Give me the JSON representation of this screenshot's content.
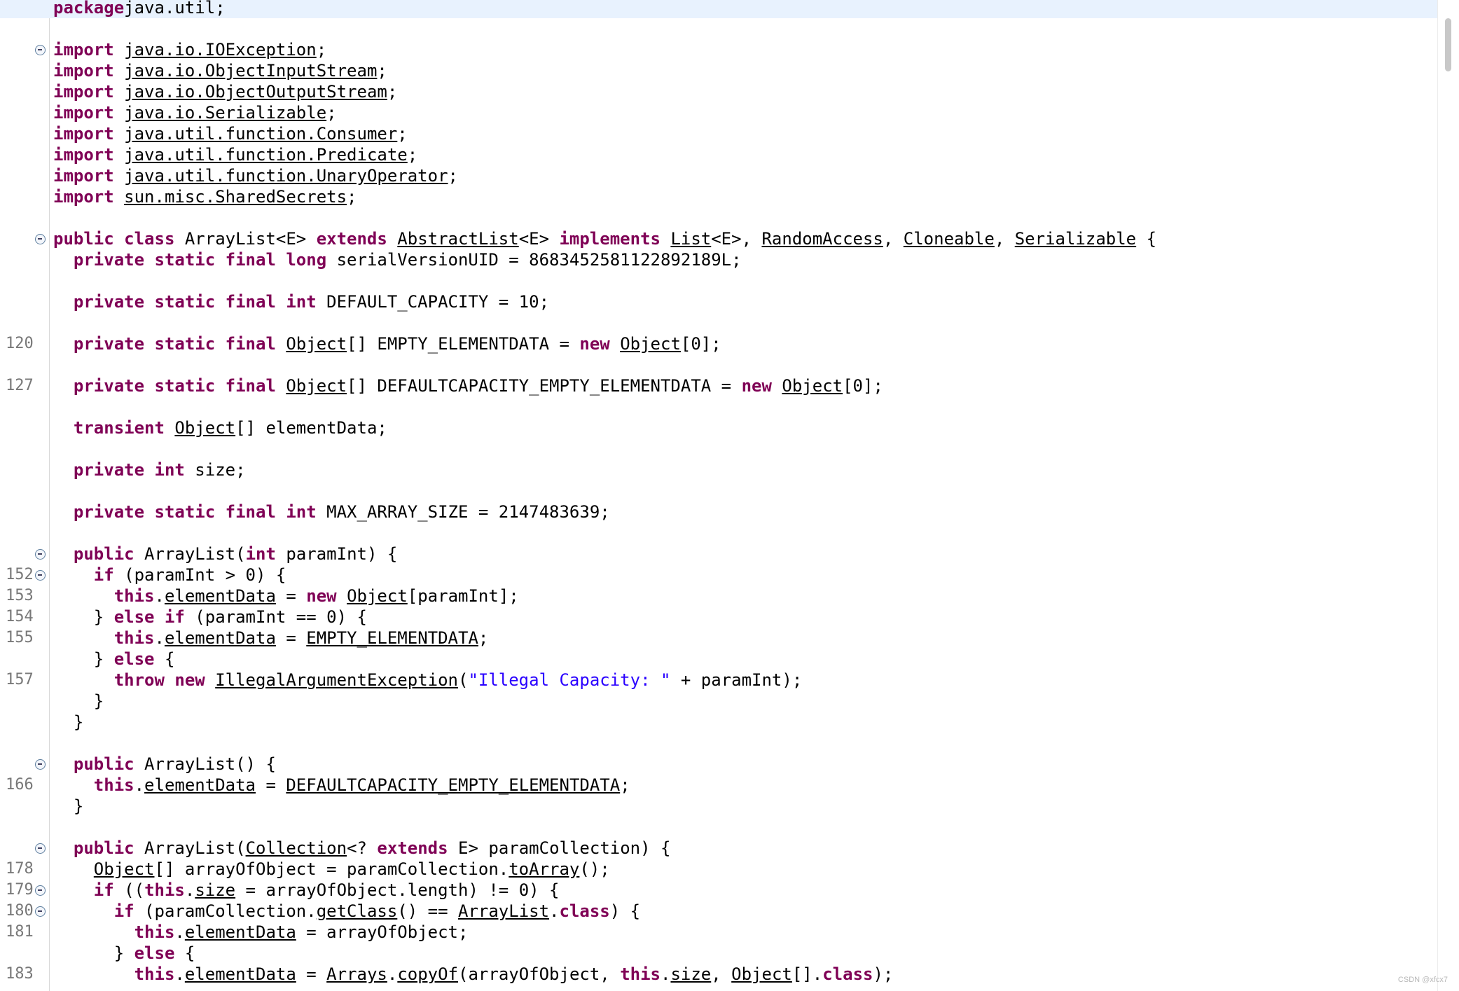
{
  "editor": {
    "lines": [
      {
        "ln": "",
        "fold": false,
        "highlight": true,
        "tokens": [
          [
            "kw",
            "package"
          ],
          [
            "",
            "java.util;"
          ]
        ]
      },
      {
        "ln": "",
        "fold": false,
        "tokens": []
      },
      {
        "ln": "",
        "fold": true,
        "tokens": [
          [
            "kw",
            "import"
          ],
          [
            "",
            " "
          ],
          [
            "ul",
            "java.io.IOException"
          ],
          [
            "",
            ";"
          ]
        ]
      },
      {
        "ln": "",
        "fold": false,
        "tokens": [
          [
            "kw",
            "import"
          ],
          [
            "",
            " "
          ],
          [
            "ul",
            "java.io.ObjectInputStream"
          ],
          [
            "",
            ";"
          ]
        ]
      },
      {
        "ln": "",
        "fold": false,
        "tokens": [
          [
            "kw",
            "import"
          ],
          [
            "",
            " "
          ],
          [
            "ul",
            "java.io.ObjectOutputStream"
          ],
          [
            "",
            ";"
          ]
        ]
      },
      {
        "ln": "",
        "fold": false,
        "tokens": [
          [
            "kw",
            "import"
          ],
          [
            "",
            " "
          ],
          [
            "ul",
            "java.io.Serializable"
          ],
          [
            "",
            ";"
          ]
        ]
      },
      {
        "ln": "",
        "fold": false,
        "tokens": [
          [
            "kw",
            "import"
          ],
          [
            "",
            " "
          ],
          [
            "ul",
            "java.util.function.Consumer"
          ],
          [
            "",
            ";"
          ]
        ]
      },
      {
        "ln": "",
        "fold": false,
        "tokens": [
          [
            "kw",
            "import"
          ],
          [
            "",
            " "
          ],
          [
            "ul",
            "java.util.function.Predicate"
          ],
          [
            "",
            ";"
          ]
        ]
      },
      {
        "ln": "",
        "fold": false,
        "tokens": [
          [
            "kw",
            "import"
          ],
          [
            "",
            " "
          ],
          [
            "ul",
            "java.util.function.UnaryOperator"
          ],
          [
            "",
            ";"
          ]
        ]
      },
      {
        "ln": "",
        "fold": false,
        "tokens": [
          [
            "kw",
            "import"
          ],
          [
            "",
            " "
          ],
          [
            "ul",
            "sun.misc.SharedSecrets"
          ],
          [
            "",
            ";"
          ]
        ]
      },
      {
        "ln": "",
        "fold": false,
        "tokens": []
      },
      {
        "ln": "",
        "fold": true,
        "tokens": [
          [
            "kw",
            "public class"
          ],
          [
            "",
            " ArrayList<E> "
          ],
          [
            "kw",
            "extends"
          ],
          [
            "",
            " "
          ],
          [
            "ul",
            "AbstractList"
          ],
          [
            "",
            "<E> "
          ],
          [
            "kw",
            "implements"
          ],
          [
            "",
            " "
          ],
          [
            "ul",
            "List"
          ],
          [
            "",
            "<E>, "
          ],
          [
            "ul",
            "RandomAccess"
          ],
          [
            "",
            ", "
          ],
          [
            "ul",
            "Cloneable"
          ],
          [
            "",
            ", "
          ],
          [
            "ul",
            "Serializable"
          ],
          [
            "",
            " {"
          ]
        ]
      },
      {
        "ln": "",
        "fold": false,
        "tokens": [
          [
            "",
            "  "
          ],
          [
            "kw",
            "private static final long"
          ],
          [
            "",
            " serialVersionUID = 8683452581122892189L;"
          ]
        ]
      },
      {
        "ln": "",
        "fold": false,
        "tokens": []
      },
      {
        "ln": "",
        "fold": false,
        "tokens": [
          [
            "",
            "  "
          ],
          [
            "kw",
            "private static final int"
          ],
          [
            "",
            " DEFAULT_CAPACITY = 10;"
          ]
        ]
      },
      {
        "ln": "",
        "fold": false,
        "tokens": []
      },
      {
        "ln": "120",
        "fold": false,
        "tokens": [
          [
            "",
            "  "
          ],
          [
            "kw",
            "private static final"
          ],
          [
            "",
            " "
          ],
          [
            "ul",
            "Object"
          ],
          [
            "",
            "[] EMPTY_ELEMENTDATA = "
          ],
          [
            "kw",
            "new"
          ],
          [
            "",
            " "
          ],
          [
            "ul",
            "Object"
          ],
          [
            "",
            "[0];"
          ]
        ]
      },
      {
        "ln": "",
        "fold": false,
        "tokens": []
      },
      {
        "ln": "127",
        "fold": false,
        "tokens": [
          [
            "",
            "  "
          ],
          [
            "kw",
            "private static final"
          ],
          [
            "",
            " "
          ],
          [
            "ul",
            "Object"
          ],
          [
            "",
            "[] DEFAULTCAPACITY_EMPTY_ELEMENTDATA = "
          ],
          [
            "kw",
            "new"
          ],
          [
            "",
            " "
          ],
          [
            "ul",
            "Object"
          ],
          [
            "",
            "[0];"
          ]
        ]
      },
      {
        "ln": "",
        "fold": false,
        "tokens": []
      },
      {
        "ln": "",
        "fold": false,
        "tokens": [
          [
            "",
            "  "
          ],
          [
            "kw",
            "transient"
          ],
          [
            "",
            " "
          ],
          [
            "ul",
            "Object"
          ],
          [
            "",
            "[] elementData;"
          ]
        ]
      },
      {
        "ln": "",
        "fold": false,
        "tokens": []
      },
      {
        "ln": "",
        "fold": false,
        "tokens": [
          [
            "",
            "  "
          ],
          [
            "kw",
            "private int"
          ],
          [
            "",
            " size;"
          ]
        ]
      },
      {
        "ln": "",
        "fold": false,
        "tokens": []
      },
      {
        "ln": "",
        "fold": false,
        "tokens": [
          [
            "",
            "  "
          ],
          [
            "kw",
            "private static final int"
          ],
          [
            "",
            " MAX_ARRAY_SIZE = 2147483639;"
          ]
        ]
      },
      {
        "ln": "",
        "fold": false,
        "tokens": []
      },
      {
        "ln": "",
        "fold": true,
        "tokens": [
          [
            "",
            "  "
          ],
          [
            "kw",
            "public"
          ],
          [
            "",
            " ArrayList("
          ],
          [
            "kw",
            "int"
          ],
          [
            "",
            " paramInt) {"
          ]
        ]
      },
      {
        "ln": "152",
        "fold": true,
        "tokens": [
          [
            "",
            "    "
          ],
          [
            "kw",
            "if"
          ],
          [
            "",
            " (paramInt > 0) {"
          ]
        ]
      },
      {
        "ln": "153",
        "fold": false,
        "tokens": [
          [
            "",
            "      "
          ],
          [
            "kw",
            "this"
          ],
          [
            "",
            "."
          ],
          [
            "ul",
            "elementData"
          ],
          [
            "",
            " = "
          ],
          [
            "kw",
            "new"
          ],
          [
            "",
            " "
          ],
          [
            "ul",
            "Object"
          ],
          [
            "",
            "[paramInt];"
          ]
        ]
      },
      {
        "ln": "154",
        "fold": false,
        "tokens": [
          [
            "",
            "    } "
          ],
          [
            "kw",
            "else if"
          ],
          [
            "",
            " (paramInt == 0) {"
          ]
        ]
      },
      {
        "ln": "155",
        "fold": false,
        "tokens": [
          [
            "",
            "      "
          ],
          [
            "kw",
            "this"
          ],
          [
            "",
            "."
          ],
          [
            "ul",
            "elementData"
          ],
          [
            "",
            " = "
          ],
          [
            "ul",
            "EMPTY_ELEMENTDATA"
          ],
          [
            "",
            ";"
          ]
        ]
      },
      {
        "ln": "",
        "fold": false,
        "tokens": [
          [
            "",
            "    } "
          ],
          [
            "kw",
            "else"
          ],
          [
            "",
            " {"
          ]
        ]
      },
      {
        "ln": "157",
        "fold": false,
        "tokens": [
          [
            "",
            "      "
          ],
          [
            "kw",
            "throw new"
          ],
          [
            "",
            " "
          ],
          [
            "ul",
            "IllegalArgumentException"
          ],
          [
            "",
            "("
          ],
          [
            "str",
            "\"Illegal Capacity: \""
          ],
          [
            "",
            " + paramInt);"
          ]
        ]
      },
      {
        "ln": "",
        "fold": false,
        "tokens": [
          [
            "",
            "    }"
          ]
        ]
      },
      {
        "ln": "",
        "fold": false,
        "tokens": [
          [
            "",
            "  }"
          ]
        ]
      },
      {
        "ln": "",
        "fold": false,
        "tokens": []
      },
      {
        "ln": "",
        "fold": true,
        "tokens": [
          [
            "",
            "  "
          ],
          [
            "kw",
            "public"
          ],
          [
            "",
            " ArrayList() {"
          ]
        ]
      },
      {
        "ln": "166",
        "fold": false,
        "tokens": [
          [
            "",
            "    "
          ],
          [
            "kw",
            "this"
          ],
          [
            "",
            "."
          ],
          [
            "ul",
            "elementData"
          ],
          [
            "",
            " = "
          ],
          [
            "ul",
            "DEFAULTCAPACITY_EMPTY_ELEMENTDATA"
          ],
          [
            "",
            ";"
          ]
        ]
      },
      {
        "ln": "",
        "fold": false,
        "tokens": [
          [
            "",
            "  }"
          ]
        ]
      },
      {
        "ln": "",
        "fold": false,
        "tokens": []
      },
      {
        "ln": "",
        "fold": true,
        "tokens": [
          [
            "",
            "  "
          ],
          [
            "kw",
            "public"
          ],
          [
            "",
            " ArrayList("
          ],
          [
            "ul",
            "Collection"
          ],
          [
            "",
            "<? "
          ],
          [
            "kw",
            "extends"
          ],
          [
            "",
            " E> paramCollection) {"
          ]
        ]
      },
      {
        "ln": "178",
        "fold": false,
        "tokens": [
          [
            "",
            "    "
          ],
          [
            "ul",
            "Object"
          ],
          [
            "",
            "[] arrayOfObject = paramCollection."
          ],
          [
            "ul",
            "toArray"
          ],
          [
            "",
            "();"
          ]
        ]
      },
      {
        "ln": "179",
        "fold": true,
        "tokens": [
          [
            "",
            "    "
          ],
          [
            "kw",
            "if"
          ],
          [
            "",
            " (("
          ],
          [
            "kw",
            "this"
          ],
          [
            "",
            "."
          ],
          [
            "ul",
            "size"
          ],
          [
            "",
            " = arrayOfObject.length) != 0) {"
          ]
        ]
      },
      {
        "ln": "180",
        "fold": true,
        "tokens": [
          [
            "",
            "      "
          ],
          [
            "kw",
            "if"
          ],
          [
            "",
            " (paramCollection."
          ],
          [
            "ul",
            "getClass"
          ],
          [
            "",
            "() == "
          ],
          [
            "ul",
            "ArrayList"
          ],
          [
            "",
            "."
          ],
          [
            "kw",
            "class"
          ],
          [
            "",
            ") {"
          ]
        ]
      },
      {
        "ln": "181",
        "fold": false,
        "tokens": [
          [
            "",
            "        "
          ],
          [
            "kw",
            "this"
          ],
          [
            "",
            "."
          ],
          [
            "ul",
            "elementData"
          ],
          [
            "",
            " = arrayOfObject;"
          ]
        ]
      },
      {
        "ln": "",
        "fold": false,
        "tokens": [
          [
            "",
            "      } "
          ],
          [
            "kw",
            "else"
          ],
          [
            "",
            " {"
          ]
        ]
      },
      {
        "ln": "183",
        "fold": false,
        "tokens": [
          [
            "",
            "        "
          ],
          [
            "kw",
            "this"
          ],
          [
            "",
            "."
          ],
          [
            "ul",
            "elementData"
          ],
          [
            "",
            " = "
          ],
          [
            "ul",
            "Arrays"
          ],
          [
            "",
            "."
          ],
          [
            "ul",
            "copyOf"
          ],
          [
            "",
            "(arrayOfObject, "
          ],
          [
            "kw",
            "this"
          ],
          [
            "",
            "."
          ],
          [
            "ul",
            "size"
          ],
          [
            "",
            ", "
          ],
          [
            "ul",
            "Object"
          ],
          [
            "",
            "[]."
          ],
          [
            "kw",
            "class"
          ],
          [
            "",
            ");"
          ]
        ]
      }
    ]
  },
  "watermark": "CSDN @xfcx7"
}
